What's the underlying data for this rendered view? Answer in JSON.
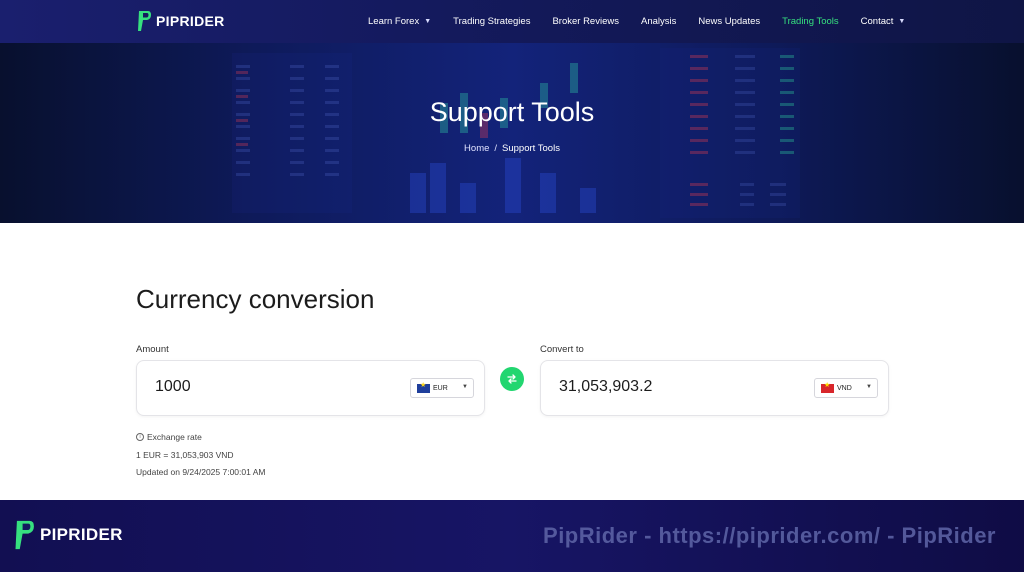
{
  "brand": {
    "name": "PIPRIDER",
    "accent": "#36e07f",
    "nav_bg": "#141a5e"
  },
  "nav": {
    "items": [
      {
        "label": "Learn Forex",
        "has_dropdown": true
      },
      {
        "label": "Trading Strategies"
      },
      {
        "label": "Broker Reviews"
      },
      {
        "label": "Analysis"
      },
      {
        "label": "News Updates"
      },
      {
        "label": "Trading Tools",
        "active": true
      },
      {
        "label": "Contact",
        "has_dropdown": true
      }
    ]
  },
  "hero": {
    "title": "Support Tools",
    "breadcrumb": {
      "home": "Home",
      "separator": "/",
      "current": "Support Tools"
    }
  },
  "converter": {
    "title": "Currency conversion",
    "amount": {
      "label": "Amount",
      "value": "1000",
      "currency": "EUR",
      "flag": "eu-flag-icon"
    },
    "convert_to": {
      "label": "Convert to",
      "value": "31,053,903.2",
      "currency": "VND",
      "flag": "vn-flag-icon"
    },
    "swap_icon": "swap-arrows-icon",
    "exchange_rate_label": "Exchange rate",
    "rate_line": "1 EUR = 31,053,903 VND",
    "updated": "Updated on 9/24/2025 7:00:01 AM"
  },
  "footer": {
    "brand": "PIPRIDER",
    "watermark": "PipRider - https://piprider.com/ - PipRider"
  }
}
